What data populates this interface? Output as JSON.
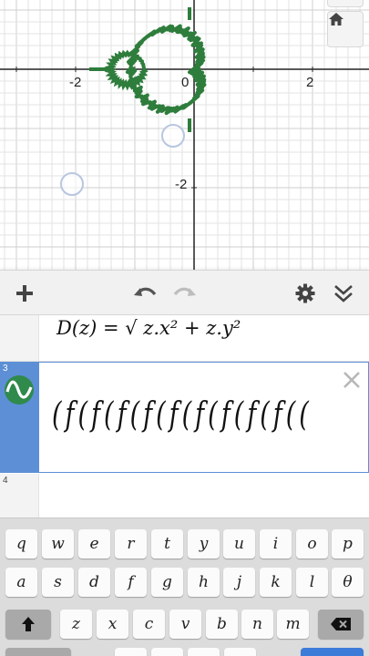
{
  "graph": {
    "x_tick_labels": [
      "-2",
      "0",
      "2"
    ],
    "y_tick_labels": [
      "-2"
    ],
    "curve_color": "#2e7d3c",
    "grid_color": "#e3e3e3",
    "axis_color": "#222222",
    "home_icon": "home-icon"
  },
  "toolbar": {
    "add_icon": "plus-icon",
    "undo_icon": "undo-icon",
    "redo_icon": "redo-icon",
    "settings_icon": "gear-icon",
    "collapse_icon": "double-chevron-down-icon"
  },
  "expressions": [
    {
      "number": "",
      "latex_display": "D(z) = √ z.x² + z.y²"
    },
    {
      "number": "3",
      "icon": "wave-icon",
      "latex_display": "(f(f(f(f(f(f(f(f(f((",
      "close_icon": "close-icon"
    },
    {
      "number": "4",
      "latex_display": ""
    }
  ],
  "keyboard": {
    "row1": [
      "q",
      "w",
      "e",
      "r",
      "t",
      "y",
      "u",
      "i",
      "o",
      "p"
    ],
    "row2": [
      "a",
      "s",
      "d",
      "f",
      "g",
      "h",
      "j",
      "k",
      "l",
      "θ"
    ],
    "row3": [
      "z",
      "x",
      "c",
      "v",
      "b",
      "n",
      "m"
    ],
    "shift_icon": "shift-arrow-icon",
    "backspace_icon": "backspace-icon"
  },
  "colors": {
    "accent_blue": "#5d8fd6",
    "curve_green": "#2e7d3c",
    "keyboard_bg": "#dcdcdc"
  }
}
